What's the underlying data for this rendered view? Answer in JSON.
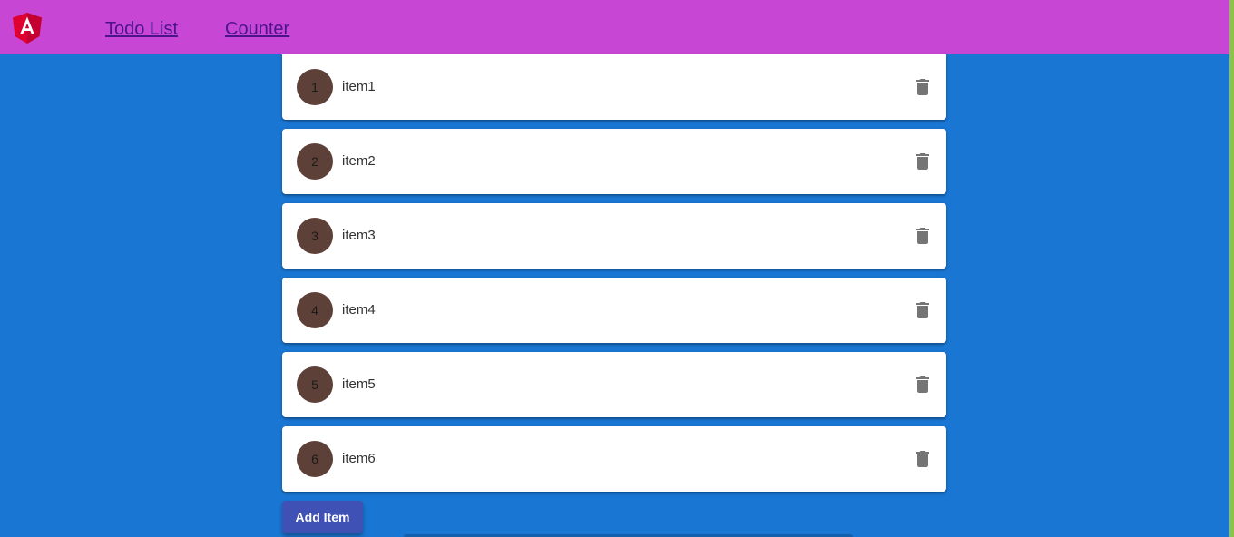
{
  "header": {
    "logo_icon": "angular-logo-icon",
    "nav": [
      {
        "label": "Todo List"
      },
      {
        "label": "Counter"
      }
    ]
  },
  "todos": [
    {
      "number": "1",
      "label": "item1"
    },
    {
      "number": "2",
      "label": "item2"
    },
    {
      "number": "3",
      "label": "item3"
    },
    {
      "number": "4",
      "label": "item4"
    },
    {
      "number": "5",
      "label": "item5"
    },
    {
      "number": "6",
      "label": "item6"
    }
  ],
  "delete_icon": "trash-icon",
  "add_button": {
    "label": "Add Item"
  },
  "colors": {
    "toolbar": "#c846d4",
    "background": "#1976d2",
    "avatar": "#5d4037",
    "button": "#3f51b5",
    "logo": "#dd0031"
  }
}
